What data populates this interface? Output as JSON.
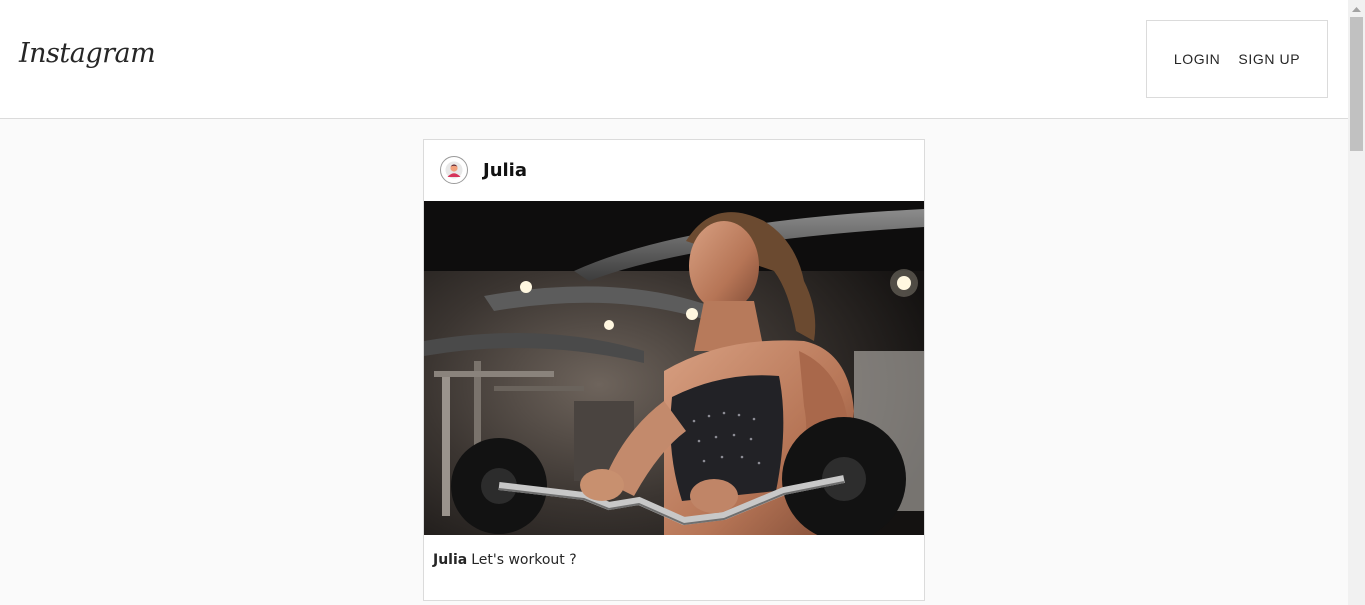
{
  "header": {
    "logo_text": "Instagram",
    "login_label": "LOGIN",
    "signup_label": "SIGN UP"
  },
  "post": {
    "username": "Julia",
    "caption_user": "Julia",
    "caption_text": "Let's workout ?",
    "image_subject": "woman-lifting-barbell-in-gym"
  },
  "colors": {
    "background": "#fafafa",
    "border": "#dbdbdb",
    "text": "#262626"
  }
}
